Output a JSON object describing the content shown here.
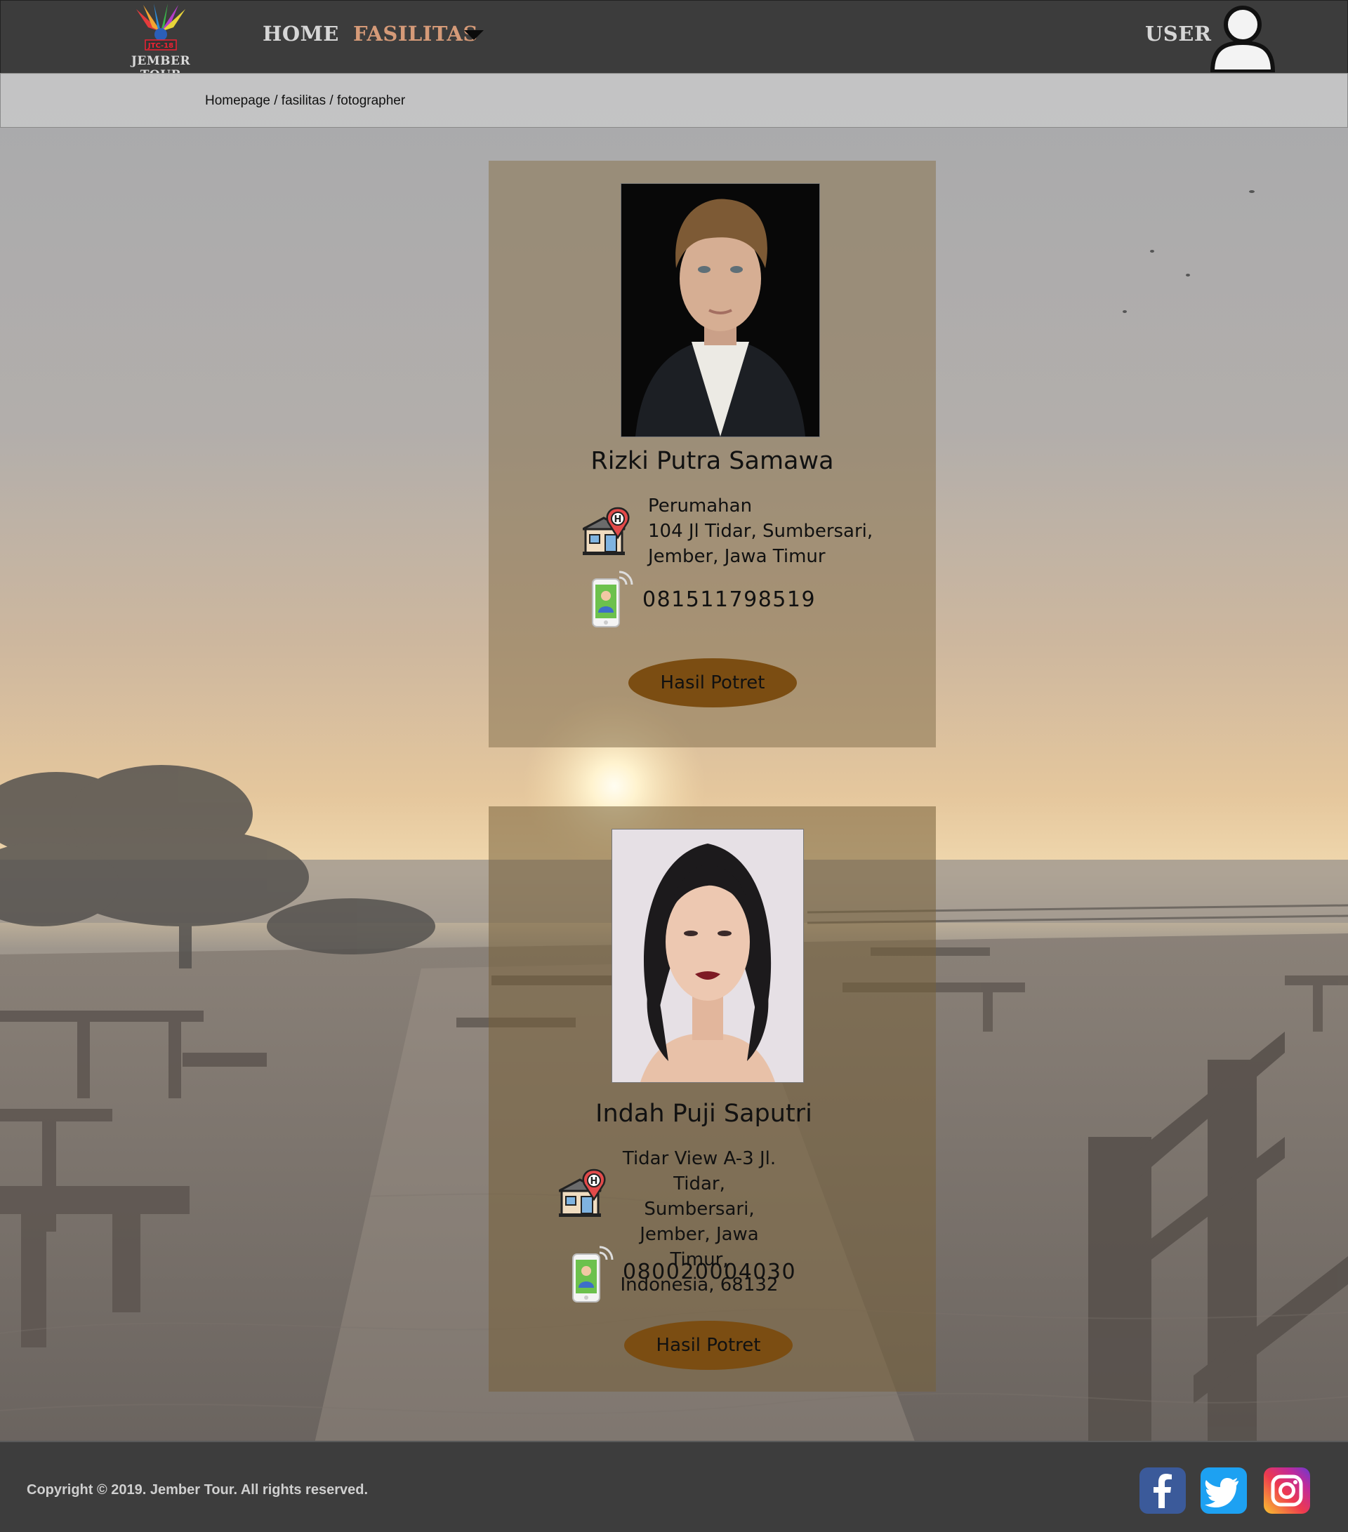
{
  "header": {
    "logo_text": "JEMBER TOUR",
    "nav": {
      "home": "HOME",
      "fasilitas": "FASILITAS",
      "user": "USER"
    }
  },
  "breadcrumb": {
    "items": [
      "Homepage",
      "fasilitas",
      "fotographer"
    ],
    "separator": " / "
  },
  "photographers": [
    {
      "name": "Rizki Putra Samawa",
      "address_lines": [
        "Perumahan",
        "104 Jl Tidar, Sumbersari,",
        "Jember, Jawa Timur"
      ],
      "phone": "081511798519",
      "button": "Hasil Potret"
    },
    {
      "name": "Indah Puji Saputri",
      "address_lines": [
        "Tidar View A-3 Jl. Tidar,",
        "Sumbersari,",
        "Jember, Jawa Timur,",
        "Indonesia, 68132"
      ],
      "phone": "080020004030",
      "button": "Hasil Potret"
    }
  ],
  "footer": {
    "copyright": "Copyright © 2019. Jember Tour. All rights reserved."
  },
  "colors": {
    "header_bg": "#3c3c3c",
    "nav_active": "#d59a78",
    "button_bg": "#7b4d12",
    "facebook": "#3b5a9a",
    "twitter": "#1da1f2"
  },
  "icons": [
    "user-avatar-icon",
    "caret-down-icon",
    "hotel-location-icon",
    "phone-call-icon",
    "facebook-icon",
    "twitter-icon",
    "instagram-icon"
  ]
}
